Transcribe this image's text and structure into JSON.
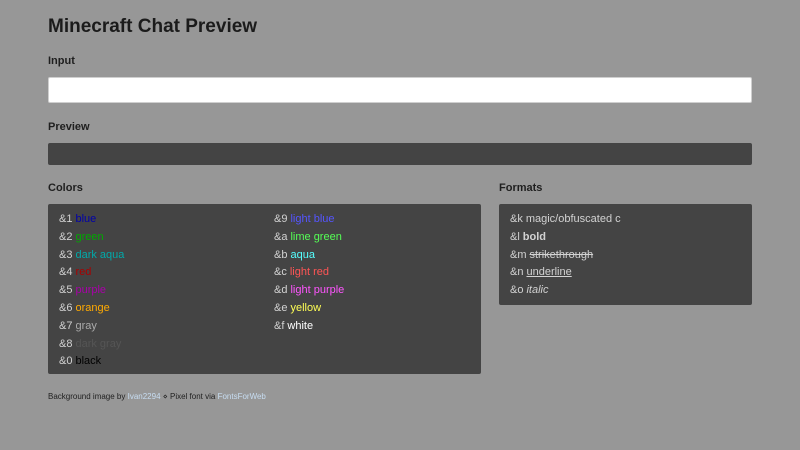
{
  "page": {
    "title": "Minecraft Chat Preview"
  },
  "input_section": {
    "label": "Input",
    "value": "",
    "placeholder": ""
  },
  "preview_section": {
    "label": "Preview",
    "content": ""
  },
  "colors_section": {
    "label": "Colors",
    "left_column": [
      {
        "code": "&1",
        "name": "blue",
        "color": "#0000aa"
      },
      {
        "code": "&2",
        "name": "green",
        "color": "#00aa00"
      },
      {
        "code": "&3",
        "name": "dark aqua",
        "color": "#00aaaa"
      },
      {
        "code": "&4",
        "name": "red",
        "color": "#aa0000"
      },
      {
        "code": "&5",
        "name": "purple",
        "color": "#aa00aa"
      },
      {
        "code": "&6",
        "name": "orange",
        "color": "#ffaa00"
      },
      {
        "code": "&7",
        "name": "gray",
        "color": "#aaaaaa"
      },
      {
        "code": "&8",
        "name": "dark gray",
        "color": "#555555"
      },
      {
        "code": "&0",
        "name": "black",
        "color": "#000000"
      }
    ],
    "right_column": [
      {
        "code": "&9",
        "name": "light blue",
        "color": "#5555ff"
      },
      {
        "code": "&a",
        "name": "lime green",
        "color": "#55ff55"
      },
      {
        "code": "&b",
        "name": "aqua",
        "color": "#55ffff"
      },
      {
        "code": "&c",
        "name": "light red",
        "color": "#ff5555"
      },
      {
        "code": "&d",
        "name": "light purple",
        "color": "#ff55ff"
      },
      {
        "code": "&e",
        "name": "yellow",
        "color": "#ffff55"
      },
      {
        "code": "&f",
        "name": "white",
        "color": "#ffffff"
      }
    ]
  },
  "formats_section": {
    "label": "Formats",
    "items": [
      {
        "code": "&k",
        "name": "magic/obfuscated c",
        "style": "magic"
      },
      {
        "code": "&l",
        "name": "bold",
        "style": "bold"
      },
      {
        "code": "&m",
        "name": "strikethrough",
        "style": "strike"
      },
      {
        "code": "&n",
        "name": "underline",
        "style": "under"
      },
      {
        "code": "&o",
        "name": "italic",
        "style": "ital"
      }
    ]
  },
  "footer": {
    "prefix": "Background image by ",
    "author_link": "Ivan2294",
    "separator": " ⋄ Pixel font via ",
    "font_link": "FontsForWeb"
  }
}
